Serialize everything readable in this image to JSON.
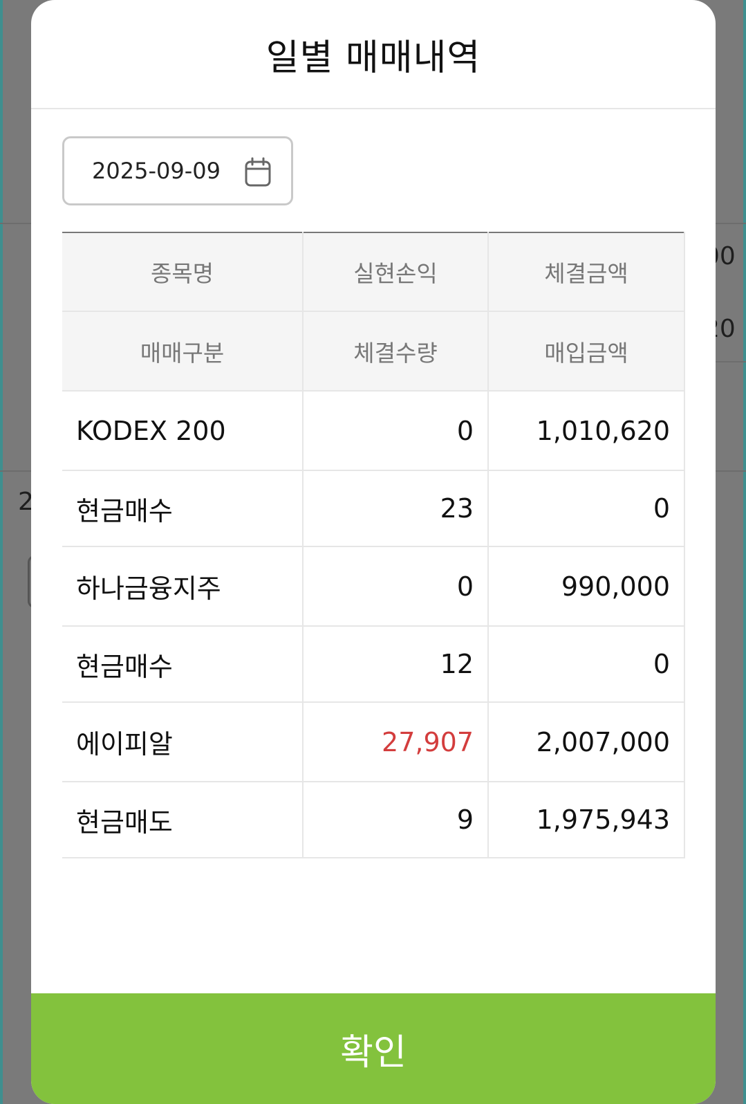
{
  "modal": {
    "title": "일별 매매내역",
    "date_value": "2025-09-09",
    "confirm_label": "확인"
  },
  "table": {
    "headers_row1": [
      "종목명",
      "실현손익",
      "체결금액"
    ],
    "headers_row2": [
      "매매구분",
      "체결수량",
      "매입금액"
    ],
    "rows": [
      [
        "KODEX 200",
        "0",
        "1,010,620"
      ],
      [
        "현금매수",
        "23",
        "0"
      ],
      [
        "하나금융지주",
        "0",
        "990,000"
      ],
      [
        "현금매수",
        "12",
        "0"
      ],
      [
        "에이피알",
        "27,907",
        "2,007,000"
      ],
      [
        "현금매도",
        "9",
        "1,975,943"
      ]
    ]
  },
  "background": {
    "right_text_1": "00",
    "right_text_2": "20",
    "left_text": "2"
  },
  "colors": {
    "confirm_bg": "#83c23d",
    "profit_positive": "#d33d3d",
    "overlay": "#7a7a7a"
  },
  "icons": {
    "date_picker": "calendar-icon"
  }
}
